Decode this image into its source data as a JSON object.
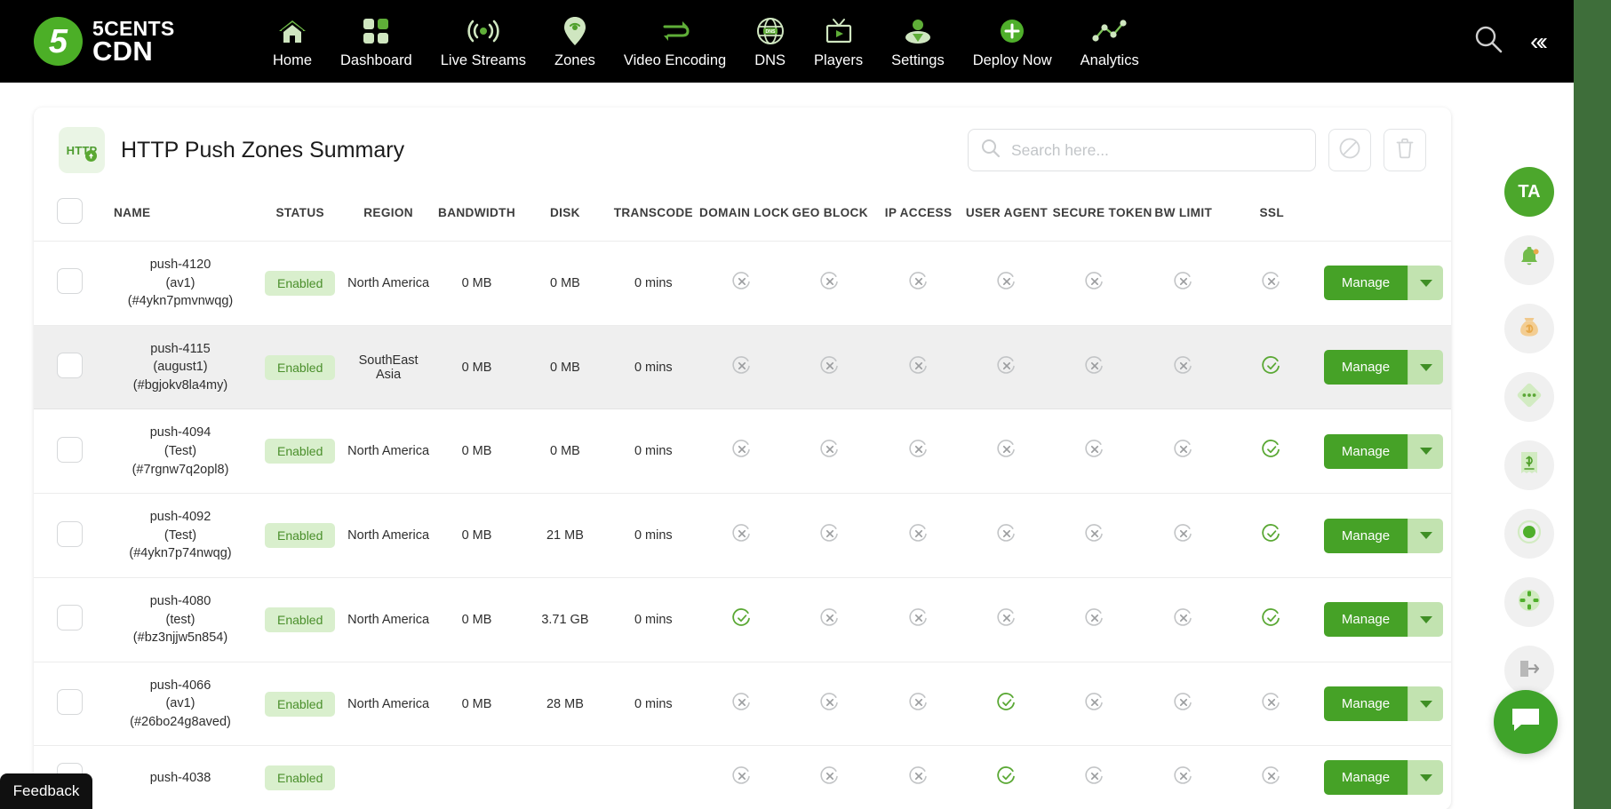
{
  "brand": {
    "line1": "5CENTS",
    "line2": "CDN",
    "mark": "5"
  },
  "topnav": {
    "items": [
      {
        "label": "Home",
        "icon": "home-icon"
      },
      {
        "label": "Dashboard",
        "icon": "grid-icon"
      },
      {
        "label": "Live Streams",
        "icon": "broadcast-icon"
      },
      {
        "label": "Zones",
        "icon": "location-pin-icon"
      },
      {
        "label": "Video Encoding",
        "icon": "transcode-arrows-icon"
      },
      {
        "label": "DNS",
        "icon": "globe-dns-icon"
      },
      {
        "label": "Players",
        "icon": "tv-play-icon"
      },
      {
        "label": "Settings",
        "icon": "user-settings-icon"
      },
      {
        "label": "Deploy Now",
        "icon": "plus-circle-icon"
      },
      {
        "label": "Analytics",
        "icon": "line-chart-icon"
      }
    ],
    "search_icon": "search-icon",
    "collapse_icon": "collapse-left-icon",
    "collapse_glyph": "«‹"
  },
  "card": {
    "badge_text": "HTTP",
    "badge_icon": "http-push-badge-icon",
    "title": "HTTP Push Zones Summary",
    "search": {
      "placeholder": "Search here...",
      "value": "",
      "icon": "search-icon"
    },
    "disable_button": {
      "icon": "ban-circle-icon",
      "title": "Disable"
    },
    "delete_button": {
      "icon": "trash-icon",
      "title": "Delete"
    }
  },
  "table": {
    "columns": [
      "",
      "NAME",
      "STATUS",
      "REGION",
      "BANDWIDTH",
      "DISK",
      "TRANSCODE",
      "DOMAIN LOCK",
      "GEO BLOCK",
      "IP ACCESS",
      "USER AGENT",
      "SECURE TOKEN",
      "BW LIMIT",
      "SSL",
      ""
    ],
    "manage_label": "Manage",
    "rows": [
      {
        "name": "push-4120",
        "alias": "(av1)",
        "id": "(#4ykn7pmvnwqg)",
        "status": "Enabled",
        "region": "North America",
        "bandwidth": "0 MB",
        "disk": "0 MB",
        "transcode": "0 mins",
        "domain_lock": false,
        "geo_block": false,
        "ip_access": false,
        "user_agent": false,
        "secure_token": false,
        "bw_limit": false,
        "ssl": false
      },
      {
        "name": "push-4115",
        "alias": "(august1)",
        "id": "(#bgjokv8la4my)",
        "status": "Enabled",
        "region": "SouthEast Asia",
        "bandwidth": "0 MB",
        "disk": "0 MB",
        "transcode": "0 mins",
        "domain_lock": false,
        "geo_block": false,
        "ip_access": false,
        "user_agent": false,
        "secure_token": false,
        "bw_limit": false,
        "ssl": true
      },
      {
        "name": "push-4094",
        "alias": "(Test)",
        "id": "(#7rgnw7q2opl8)",
        "status": "Enabled",
        "region": "North America",
        "bandwidth": "0 MB",
        "disk": "0 MB",
        "transcode": "0 mins",
        "domain_lock": false,
        "geo_block": false,
        "ip_access": false,
        "user_agent": false,
        "secure_token": false,
        "bw_limit": false,
        "ssl": true
      },
      {
        "name": "push-4092",
        "alias": "(Test)",
        "id": "(#4ykn7p74nwqg)",
        "status": "Enabled",
        "region": "North America",
        "bandwidth": "0 MB",
        "disk": "21 MB",
        "transcode": "0 mins",
        "domain_lock": false,
        "geo_block": false,
        "ip_access": false,
        "user_agent": false,
        "secure_token": false,
        "bw_limit": false,
        "ssl": true
      },
      {
        "name": "push-4080",
        "alias": "(test)",
        "id": "(#bz3njjw5n854)",
        "status": "Enabled",
        "region": "North America",
        "bandwidth": "0 MB",
        "disk": "3.71 GB",
        "transcode": "0 mins",
        "domain_lock": true,
        "geo_block": false,
        "ip_access": false,
        "user_agent": false,
        "secure_token": false,
        "bw_limit": false,
        "ssl": true
      },
      {
        "name": "push-4066",
        "alias": "(av1)",
        "id": "(#26bo24g8aved)",
        "status": "Enabled",
        "region": "North America",
        "bandwidth": "0 MB",
        "disk": "28 MB",
        "transcode": "0 mins",
        "domain_lock": false,
        "geo_block": false,
        "ip_access": false,
        "user_agent": true,
        "secure_token": false,
        "bw_limit": false,
        "ssl": false
      },
      {
        "name": "push-4038",
        "alias": "",
        "id": "",
        "status": "Enabled",
        "region": "",
        "bandwidth": "",
        "disk": "",
        "transcode": "",
        "domain_lock": false,
        "geo_block": false,
        "ip_access": false,
        "user_agent": true,
        "secure_token": false,
        "bw_limit": false,
        "ssl": false
      }
    ]
  },
  "rail": {
    "avatar": "TA",
    "items": [
      {
        "icon": "bell-notification-icon",
        "name": "notifications"
      },
      {
        "icon": "money-bag-icon",
        "name": "billing-credits"
      },
      {
        "icon": "diamond-dots-icon",
        "name": "more-options"
      },
      {
        "icon": "receipt-dollar-icon",
        "name": "invoices"
      },
      {
        "icon": "record-circle-icon",
        "name": "recordings"
      },
      {
        "icon": "crosshair-icon",
        "name": "targeting"
      },
      {
        "icon": "logout-arrow-icon",
        "name": "logout"
      }
    ],
    "chat_icon": "chat-bubble-icon"
  },
  "feedback": {
    "label": "Feedback"
  },
  "colors": {
    "brand_green": "#4caf27",
    "nav_bg": "#000000",
    "manage_green": "#46a227",
    "badge_bg": "#d9efcd",
    "badge_text": "#4a8f2b",
    "rail_strip": "#3e6e3a",
    "alt_row": "#efefef"
  }
}
